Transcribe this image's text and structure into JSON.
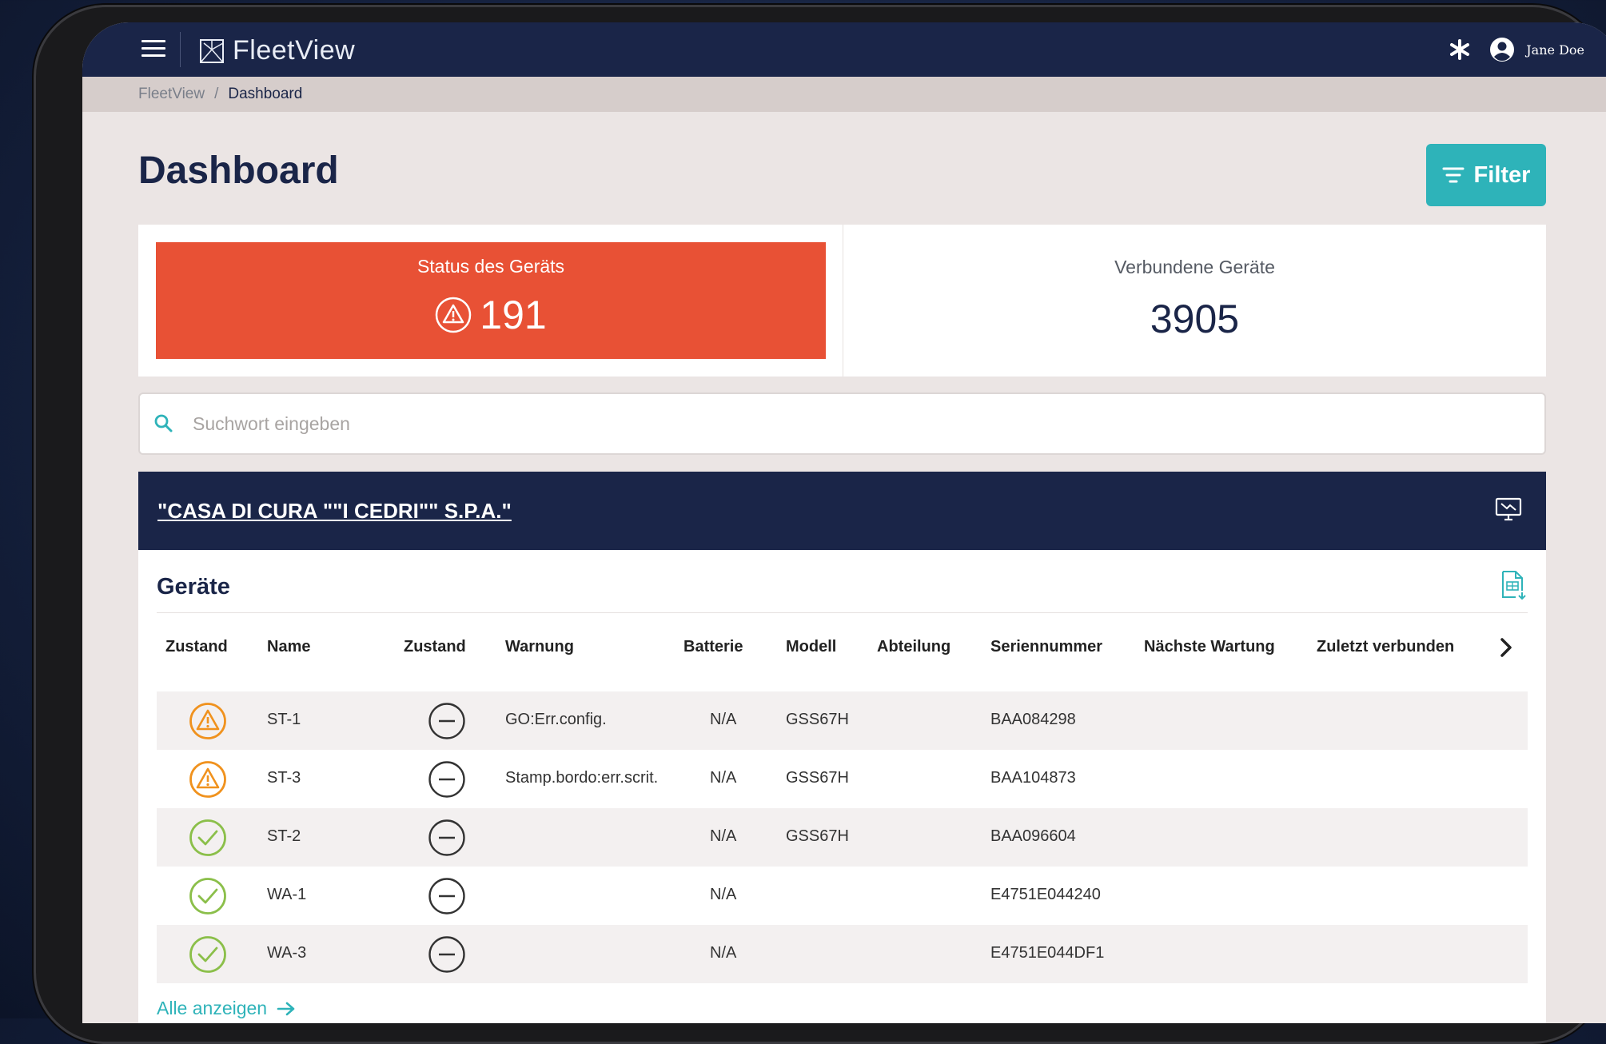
{
  "app": {
    "name": "FleetView",
    "user_name": "Jane Doe"
  },
  "breadcrumb": {
    "root": "FleetView",
    "separator": "/",
    "current": "Dashboard"
  },
  "page": {
    "title": "Dashboard",
    "filter_label": "Filter"
  },
  "stats": {
    "status": {
      "label": "Status des Geräts",
      "value": "191",
      "color": "#e85135"
    },
    "connected": {
      "label": "Verbundene Geräte",
      "value": "3905"
    }
  },
  "search": {
    "placeholder": "Suchwort eingeben",
    "value": ""
  },
  "customer": {
    "name": "\"CASA DI CURA \"\"I CEDRI\"\" S.P.A.\""
  },
  "devices": {
    "title": "Geräte",
    "columns": [
      "Zustand",
      "Name",
      "Zustand",
      "Warnung",
      "Batterie",
      "Modell",
      "Abteilung",
      "Seriennummer",
      "Nächste Wartung",
      "Zuletzt verbunden"
    ],
    "rows": [
      {
        "status": "warning",
        "name": "ST-1",
        "warning": "GO:Err.config.",
        "battery": "N/A",
        "model": "GSS67H",
        "department": "",
        "serial": "BAA084298",
        "next_service": "",
        "last_connected": ""
      },
      {
        "status": "warning",
        "name": "ST-3",
        "warning": "Stamp.bordo:err.scrit.",
        "battery": "N/A",
        "model": "GSS67H",
        "department": "",
        "serial": "BAA104873",
        "next_service": "",
        "last_connected": ""
      },
      {
        "status": "ok",
        "name": "ST-2",
        "warning": "",
        "battery": "N/A",
        "model": "GSS67H",
        "department": "",
        "serial": "BAA096604",
        "next_service": "",
        "last_connected": ""
      },
      {
        "status": "ok",
        "name": "WA-1",
        "warning": "",
        "battery": "N/A",
        "model": "",
        "department": "",
        "serial": "E4751E044240",
        "next_service": "",
        "last_connected": ""
      },
      {
        "status": "ok",
        "name": "WA-3",
        "warning": "",
        "battery": "N/A",
        "model": "",
        "department": "",
        "serial": "E4751E044DF1",
        "next_service": "",
        "last_connected": ""
      }
    ],
    "show_all_label": "Alle anzeigen"
  },
  "colors": {
    "navy": "#1a2548",
    "teal": "#2eb3b9",
    "alert_red": "#e85135",
    "warning_orange": "#f0921e",
    "ok_green": "#8bbf4a"
  },
  "icons": [
    "menu-icon",
    "fleetview-logo-icon",
    "asterisk-icon",
    "user-icon",
    "filter-icon",
    "alert-triangle-icon",
    "search-icon",
    "monitor-icon",
    "export-sheet-icon",
    "chevron-right-icon",
    "warning-icon",
    "check-icon",
    "minus-circle-icon",
    "arrow-right-icon"
  ]
}
